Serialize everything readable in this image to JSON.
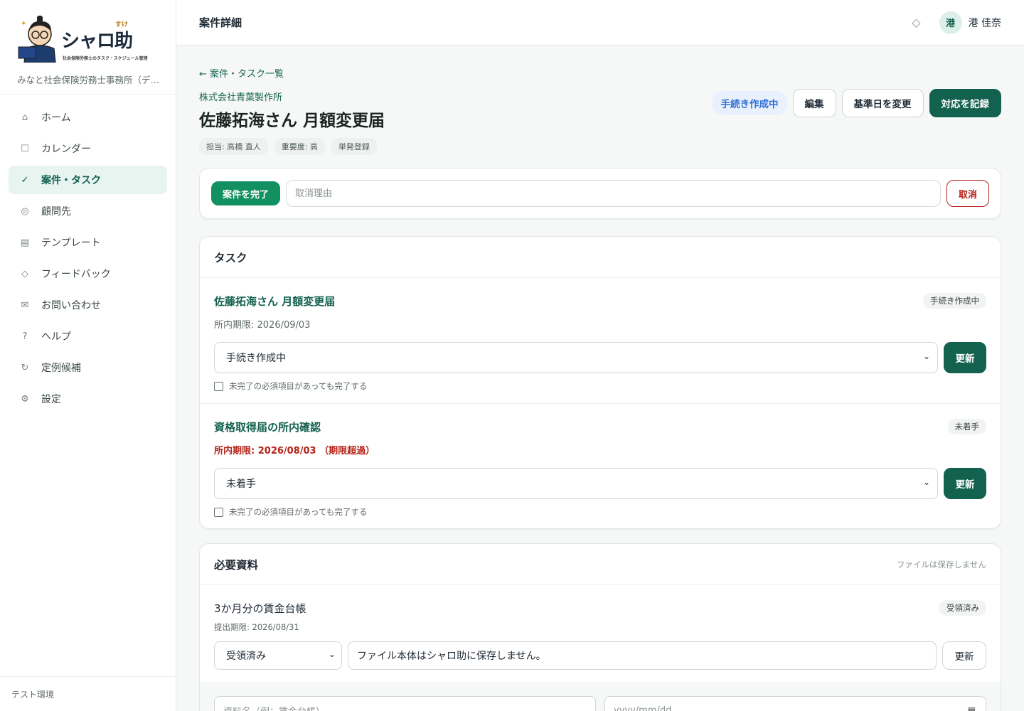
{
  "brand": {
    "logo_text": "シャロ助",
    "logo_ruby": "すけ",
    "logo_sub": "社会保険労務士のタスク・スケジュール管理",
    "office_name": "みなと社会保険労務士事務所（デ…"
  },
  "nav": [
    {
      "label": "ホーム",
      "icon": "home-icon",
      "glyph": "⌂",
      "active": false
    },
    {
      "label": "カレンダー",
      "icon": "calendar-icon",
      "glyph": "☐",
      "active": false
    },
    {
      "label": "案件・タスク",
      "icon": "check-icon",
      "glyph": "✓",
      "active": true
    },
    {
      "label": "顧問先",
      "icon": "client-icon",
      "glyph": "◎",
      "active": false
    },
    {
      "label": "テンプレート",
      "icon": "template-icon",
      "glyph": "▤",
      "active": false
    },
    {
      "label": "フィードバック",
      "icon": "feedback-icon",
      "glyph": "◇",
      "active": false
    },
    {
      "label": "お問い合わせ",
      "icon": "mail-icon",
      "glyph": "✉",
      "active": false
    },
    {
      "label": "ヘルプ",
      "icon": "help-icon",
      "glyph": "?",
      "active": false
    },
    {
      "label": "定例候補",
      "icon": "recurring-icon",
      "glyph": "↻",
      "active": false
    },
    {
      "label": "設定",
      "icon": "gear-icon",
      "glyph": "⚙",
      "active": false
    }
  ],
  "sidebar_footer": "テスト環境",
  "header": {
    "title": "案件詳細",
    "bell_glyph": "◇",
    "avatar_initial": "港",
    "user_name": "港 佳奈"
  },
  "case": {
    "back_link": "← 案件・タスク一覧",
    "client": "株式会社青葉製作所",
    "title": "佐藤拓海さん 月額変更届",
    "tags": [
      "担当: 高橋 直人",
      "重要度: 高",
      "単発登録"
    ],
    "status": "手続き作成中",
    "buttons": {
      "edit": "編集",
      "change_date": "基準日を変更",
      "record": "対応を記録"
    }
  },
  "cancel": {
    "complete_label": "案件を完了",
    "reason_placeholder": "取消理由",
    "cancel_label": "取消"
  },
  "tasks_section": {
    "title": "タスク",
    "force_label": "未完了の必須項目があっても完了する",
    "update_label": "更新",
    "items": [
      {
        "name": "佐藤拓海さん 月額変更届",
        "deadline": "所内期限: 2026/09/03",
        "overdue": false,
        "badge": "手続き作成中",
        "selected": "手続き作成中"
      },
      {
        "name": "資格取得届の所内確認",
        "deadline": "所内期限: 2026/08/03 （期限超過）",
        "overdue": true,
        "badge": "未着手",
        "selected": "未着手"
      }
    ]
  },
  "docs_section": {
    "title": "必要資料",
    "note": "ファイルは保存しません",
    "update_label": "更新",
    "items": [
      {
        "name": "3か月分の賃金台帳",
        "deadline": "提出期限: 2026/08/31",
        "badge": "受領済み",
        "selected": "受領済み",
        "memo": "ファイル本体はシャロ助に保存しません。"
      }
    ],
    "new_name_placeholder": "資料名（例：賃金台帳）",
    "new_date_placeholder": "yyyy/mm/dd"
  }
}
